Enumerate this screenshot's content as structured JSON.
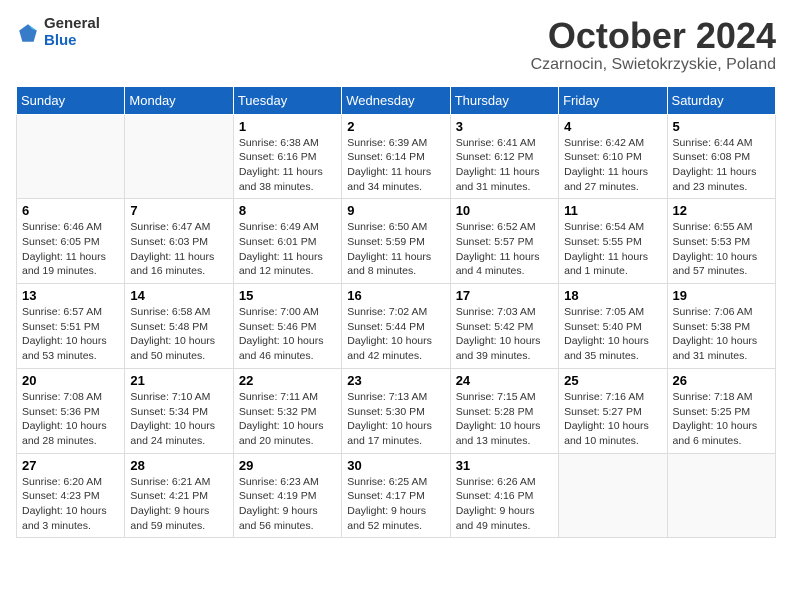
{
  "header": {
    "logo_general": "General",
    "logo_blue": "Blue",
    "month": "October 2024",
    "location": "Czarnocin, Swietokrzyskie, Poland"
  },
  "weekdays": [
    "Sunday",
    "Monday",
    "Tuesday",
    "Wednesday",
    "Thursday",
    "Friday",
    "Saturday"
  ],
  "weeks": [
    [
      {
        "day": "",
        "sunrise": "",
        "sunset": "",
        "daylight": ""
      },
      {
        "day": "",
        "sunrise": "",
        "sunset": "",
        "daylight": ""
      },
      {
        "day": "1",
        "sunrise": "Sunrise: 6:38 AM",
        "sunset": "Sunset: 6:16 PM",
        "daylight": "Daylight: 11 hours and 38 minutes."
      },
      {
        "day": "2",
        "sunrise": "Sunrise: 6:39 AM",
        "sunset": "Sunset: 6:14 PM",
        "daylight": "Daylight: 11 hours and 34 minutes."
      },
      {
        "day": "3",
        "sunrise": "Sunrise: 6:41 AM",
        "sunset": "Sunset: 6:12 PM",
        "daylight": "Daylight: 11 hours and 31 minutes."
      },
      {
        "day": "4",
        "sunrise": "Sunrise: 6:42 AM",
        "sunset": "Sunset: 6:10 PM",
        "daylight": "Daylight: 11 hours and 27 minutes."
      },
      {
        "day": "5",
        "sunrise": "Sunrise: 6:44 AM",
        "sunset": "Sunset: 6:08 PM",
        "daylight": "Daylight: 11 hours and 23 minutes."
      }
    ],
    [
      {
        "day": "6",
        "sunrise": "Sunrise: 6:46 AM",
        "sunset": "Sunset: 6:05 PM",
        "daylight": "Daylight: 11 hours and 19 minutes."
      },
      {
        "day": "7",
        "sunrise": "Sunrise: 6:47 AM",
        "sunset": "Sunset: 6:03 PM",
        "daylight": "Daylight: 11 hours and 16 minutes."
      },
      {
        "day": "8",
        "sunrise": "Sunrise: 6:49 AM",
        "sunset": "Sunset: 6:01 PM",
        "daylight": "Daylight: 11 hours and 12 minutes."
      },
      {
        "day": "9",
        "sunrise": "Sunrise: 6:50 AM",
        "sunset": "Sunset: 5:59 PM",
        "daylight": "Daylight: 11 hours and 8 minutes."
      },
      {
        "day": "10",
        "sunrise": "Sunrise: 6:52 AM",
        "sunset": "Sunset: 5:57 PM",
        "daylight": "Daylight: 11 hours and 4 minutes."
      },
      {
        "day": "11",
        "sunrise": "Sunrise: 6:54 AM",
        "sunset": "Sunset: 5:55 PM",
        "daylight": "Daylight: 11 hours and 1 minute."
      },
      {
        "day": "12",
        "sunrise": "Sunrise: 6:55 AM",
        "sunset": "Sunset: 5:53 PM",
        "daylight": "Daylight: 10 hours and 57 minutes."
      }
    ],
    [
      {
        "day": "13",
        "sunrise": "Sunrise: 6:57 AM",
        "sunset": "Sunset: 5:51 PM",
        "daylight": "Daylight: 10 hours and 53 minutes."
      },
      {
        "day": "14",
        "sunrise": "Sunrise: 6:58 AM",
        "sunset": "Sunset: 5:48 PM",
        "daylight": "Daylight: 10 hours and 50 minutes."
      },
      {
        "day": "15",
        "sunrise": "Sunrise: 7:00 AM",
        "sunset": "Sunset: 5:46 PM",
        "daylight": "Daylight: 10 hours and 46 minutes."
      },
      {
        "day": "16",
        "sunrise": "Sunrise: 7:02 AM",
        "sunset": "Sunset: 5:44 PM",
        "daylight": "Daylight: 10 hours and 42 minutes."
      },
      {
        "day": "17",
        "sunrise": "Sunrise: 7:03 AM",
        "sunset": "Sunset: 5:42 PM",
        "daylight": "Daylight: 10 hours and 39 minutes."
      },
      {
        "day": "18",
        "sunrise": "Sunrise: 7:05 AM",
        "sunset": "Sunset: 5:40 PM",
        "daylight": "Daylight: 10 hours and 35 minutes."
      },
      {
        "day": "19",
        "sunrise": "Sunrise: 7:06 AM",
        "sunset": "Sunset: 5:38 PM",
        "daylight": "Daylight: 10 hours and 31 minutes."
      }
    ],
    [
      {
        "day": "20",
        "sunrise": "Sunrise: 7:08 AM",
        "sunset": "Sunset: 5:36 PM",
        "daylight": "Daylight: 10 hours and 28 minutes."
      },
      {
        "day": "21",
        "sunrise": "Sunrise: 7:10 AM",
        "sunset": "Sunset: 5:34 PM",
        "daylight": "Daylight: 10 hours and 24 minutes."
      },
      {
        "day": "22",
        "sunrise": "Sunrise: 7:11 AM",
        "sunset": "Sunset: 5:32 PM",
        "daylight": "Daylight: 10 hours and 20 minutes."
      },
      {
        "day": "23",
        "sunrise": "Sunrise: 7:13 AM",
        "sunset": "Sunset: 5:30 PM",
        "daylight": "Daylight: 10 hours and 17 minutes."
      },
      {
        "day": "24",
        "sunrise": "Sunrise: 7:15 AM",
        "sunset": "Sunset: 5:28 PM",
        "daylight": "Daylight: 10 hours and 13 minutes."
      },
      {
        "day": "25",
        "sunrise": "Sunrise: 7:16 AM",
        "sunset": "Sunset: 5:27 PM",
        "daylight": "Daylight: 10 hours and 10 minutes."
      },
      {
        "day": "26",
        "sunrise": "Sunrise: 7:18 AM",
        "sunset": "Sunset: 5:25 PM",
        "daylight": "Daylight: 10 hours and 6 minutes."
      }
    ],
    [
      {
        "day": "27",
        "sunrise": "Sunrise: 6:20 AM",
        "sunset": "Sunset: 4:23 PM",
        "daylight": "Daylight: 10 hours and 3 minutes."
      },
      {
        "day": "28",
        "sunrise": "Sunrise: 6:21 AM",
        "sunset": "Sunset: 4:21 PM",
        "daylight": "Daylight: 9 hours and 59 minutes."
      },
      {
        "day": "29",
        "sunrise": "Sunrise: 6:23 AM",
        "sunset": "Sunset: 4:19 PM",
        "daylight": "Daylight: 9 hours and 56 minutes."
      },
      {
        "day": "30",
        "sunrise": "Sunrise: 6:25 AM",
        "sunset": "Sunset: 4:17 PM",
        "daylight": "Daylight: 9 hours and 52 minutes."
      },
      {
        "day": "31",
        "sunrise": "Sunrise: 6:26 AM",
        "sunset": "Sunset: 4:16 PM",
        "daylight": "Daylight: 9 hours and 49 minutes."
      },
      {
        "day": "",
        "sunrise": "",
        "sunset": "",
        "daylight": ""
      },
      {
        "day": "",
        "sunrise": "",
        "sunset": "",
        "daylight": ""
      }
    ]
  ]
}
